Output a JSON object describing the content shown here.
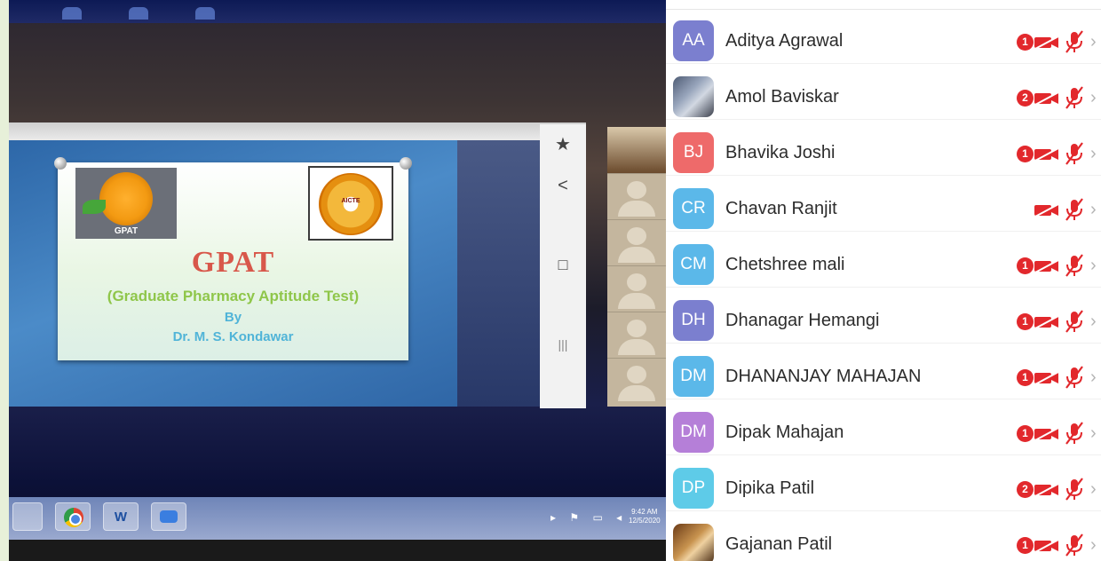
{
  "slide": {
    "title": "GPAT",
    "subtitle": "(Graduate Pharmacy Aptitude Test)",
    "by": "By",
    "author": "Dr. M. S. Kondawar",
    "logo_left_text": "GPAT",
    "logo_right_text": "AICTE"
  },
  "side_toolbar": {
    "star": "★",
    "back": "<",
    "home": "□",
    "recents": "|||"
  },
  "taskbar": {
    "word_label": "W",
    "time": "9:42 AM",
    "date": "12/5/2020"
  },
  "participants": [
    {
      "initials": "AA",
      "name": "Aditya Agrawal",
      "avatar_color": "#7b7fcf",
      "badge": "1",
      "has_photo": false
    },
    {
      "initials": "",
      "name": "Amol Baviskar",
      "avatar_color": "",
      "badge": "2",
      "has_photo": true
    },
    {
      "initials": "BJ",
      "name": "Bhavika Joshi",
      "avatar_color": "#ee6a6a",
      "badge": "1",
      "has_photo": false
    },
    {
      "initials": "CR",
      "name": "Chavan Ranjit",
      "avatar_color": "#5bb8e9",
      "badge": "",
      "has_photo": false
    },
    {
      "initials": "CM",
      "name": "Chetshree mali",
      "avatar_color": "#5bb8e9",
      "badge": "1",
      "has_photo": false
    },
    {
      "initials": "DH",
      "name": "Dhanagar Hemangi",
      "avatar_color": "#7b7fcf",
      "badge": "1",
      "has_photo": false
    },
    {
      "initials": "DM",
      "name": "DHANANJAY MAHAJAN",
      "avatar_color": "#5bb8e9",
      "badge": "1",
      "has_photo": false
    },
    {
      "initials": "DM",
      "name": "Dipak Mahajan",
      "avatar_color": "#b57fd8",
      "badge": "1",
      "has_photo": false
    },
    {
      "initials": "DP",
      "name": "Dipika Patil",
      "avatar_color": "#5ecbe8",
      "badge": "2",
      "has_photo": false
    },
    {
      "initials": "",
      "name": "Gajanan Patil",
      "avatar_color": "",
      "badge": "1",
      "has_photo": true
    }
  ],
  "colors": {
    "muted_red": "#e2282c",
    "chevron": "#b4b4b4",
    "slide_title": "#d8574a",
    "slide_subtitle": "#8fc64a",
    "slide_author": "#50b4d8"
  },
  "icons": {
    "muted_video": "video-off-icon",
    "muted_mic": "mic-off-icon",
    "row_chevron": "chevron-right-icon"
  }
}
